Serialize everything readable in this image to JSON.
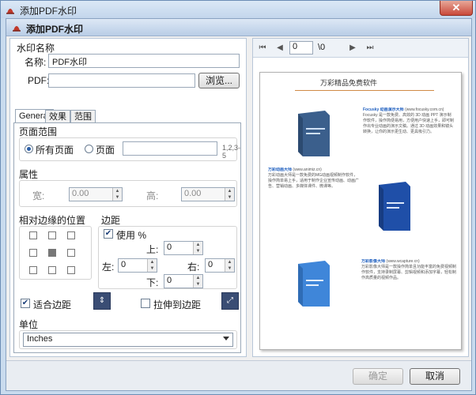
{
  "window": {
    "title": "添加PDF水印",
    "close_glyph": "✕"
  },
  "header": {
    "title": "添加PDF水印"
  },
  "left": {
    "section_title": "水印名称",
    "name_label": "名称:",
    "name_value": "PDF水印",
    "pdf_label": "PDF:",
    "pdf_value": "",
    "browse_label": "浏览...",
    "tabs": [
      "General",
      "效果",
      "范围"
    ],
    "page_range": {
      "title": "页面范围",
      "all_pages": "所有页面",
      "pages": "页面",
      "pages_value": "",
      "hint": "1,2,3-5",
      "selected": "all_pages"
    },
    "attributes": {
      "title": "属性",
      "width_label": "宽:",
      "width_value": "0.00",
      "height_label": "高:",
      "height_value": "0.00"
    },
    "relative_position": {
      "title": "相对边缘的位置",
      "selected_cell": 4
    },
    "margins": {
      "title": "边距",
      "use_label": "使用 %",
      "use_checked": true,
      "top_label": "上:",
      "top_value": "0",
      "left_label": "左:",
      "left_value": "0",
      "right_label": "右:",
      "right_value": "0",
      "bottom_label": "下:",
      "bottom_value": "0"
    },
    "fit_margin": {
      "label": "适合边距",
      "checked": true
    },
    "stretch_margin": {
      "label": "拉伸到边距",
      "checked": false
    },
    "unit": {
      "title": "单位",
      "value": "Inches"
    }
  },
  "preview": {
    "page_value": "0",
    "page_total": "\\0",
    "doc_title": "万彩精品免费软件",
    "product1_title": "Focusky 动画演示大师",
    "product1_url": "(www.focusky.com.cn)",
    "product1_text": "Focusky 是一款免费、高效的 3D 动画 PPT 演示制作软件，操作简便易用，方便用户快速上手，即可制作出专业动画的演示文稿。通过 3D 动画效果和镜头转换，让你的演示更生动、更具吸引力。",
    "product2_title": "万彩动画大师",
    "product2_url": "(www.animiz.cn)",
    "product2_text": "万彩动画大师是一款免费的MG动画视频制作软件，操作简单易上手，适用于制作企业宣传动画、动画广告、营销动画、多媒体课件、微课等。",
    "product3_title": "万彩影像大师",
    "product3_url": "(www.wcapture.cn)",
    "product3_text": "万彩影像大师是一款操作简单且功能丰富的免费视频制作软件，支持录制屏幕、剪辑视频和添加字幕，轻松制作高质量的视频作品。"
  },
  "footer": {
    "ok_label": "确定",
    "cancel_label": "取消"
  },
  "colors": {
    "accent": "#2b5fa8",
    "link": "#1f5fbf"
  }
}
